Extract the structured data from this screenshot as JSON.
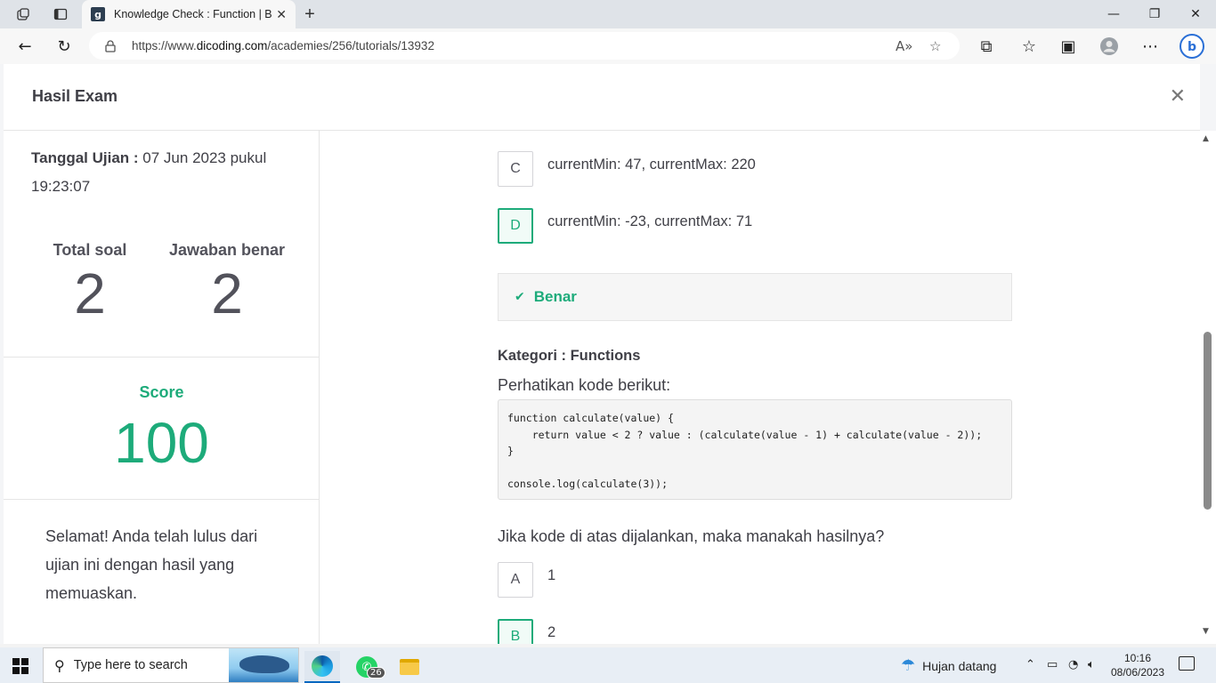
{
  "browser": {
    "tab_title": "Knowledge Check : Function | Belajar",
    "favicon_letter": "g",
    "url_scheme": "https://www.",
    "url_domain": "dicoding.com",
    "url_path": "/academies/256/tutorials/13932"
  },
  "modal": {
    "title": "Hasil Exam",
    "exam_date_label": "Tanggal Ujian :",
    "exam_date_value": " 07 Jun 2023 pukul 19:23:07",
    "total_label": "Total soal",
    "total_value": "2",
    "correct_label": "Jawaban benar",
    "correct_value": "2",
    "score_label": "Score",
    "score_value": "100",
    "pass_message": "Selamat! Anda telah lulus dari ujian ini dengan hasil yang memuaskan."
  },
  "question1": {
    "options": [
      {
        "letter": "C",
        "text": "currentMin: 47, currentMax: 220"
      },
      {
        "letter": "D",
        "text": "currentMin: -23, currentMax: 71"
      }
    ],
    "feedback": "Benar"
  },
  "question2": {
    "category": "Kategori : Functions",
    "intro": "Perhatikan kode berikut:",
    "code": "function calculate(value) {\n    return value < 2 ? value : (calculate(value - 1) + calculate(value - 2));\n}\n\nconsole.log(calculate(3));",
    "prompt": "Jika kode di atas dijalankan, maka manakah hasilnya?",
    "options": [
      {
        "letter": "A",
        "text": "1"
      },
      {
        "letter": "B",
        "text": "2"
      }
    ]
  },
  "taskbar": {
    "search_placeholder": "Type here to search",
    "whatsapp_badge": "26",
    "weather": "Hujan datang",
    "time": "10:16",
    "date": "08/06/2023"
  },
  "colors": {
    "accent_green": "#1dab7a",
    "text_dark": "#3f3f46"
  }
}
